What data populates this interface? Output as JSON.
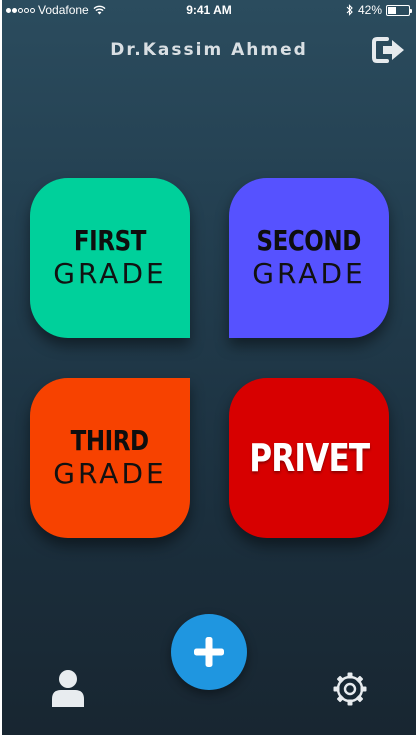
{
  "status_bar": {
    "carrier": "Vodafone",
    "signal_bars": 2,
    "time": "9:41 AM",
    "battery_percent": "42%",
    "battery_level": 0.42
  },
  "header": {
    "title": "Dr.Kassim Ahmed",
    "logout_icon": "logout-icon"
  },
  "tiles": [
    {
      "id": "first",
      "line1": "FIRST",
      "line2": "GRADE",
      "color": "#00d09b"
    },
    {
      "id": "second",
      "line1": "SECOND",
      "line2": "GRADE",
      "color": "#5652ff"
    },
    {
      "id": "third",
      "line1": "THIRD",
      "line2": "GRADE",
      "color": "#f74200"
    },
    {
      "id": "privet",
      "line1": "PRIVET",
      "color": "#d70000"
    }
  ],
  "bottom_bar": {
    "add_icon": "plus-icon",
    "add_color": "#1f96e0",
    "profile_icon": "user-icon",
    "settings_icon": "gear-icon"
  }
}
